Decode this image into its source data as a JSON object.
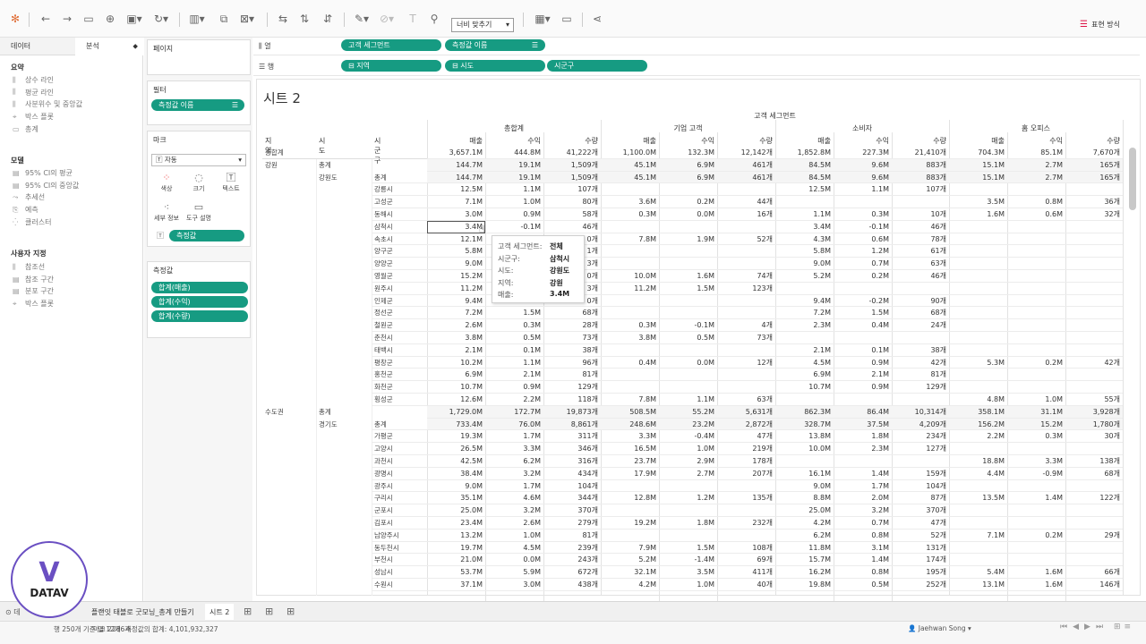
{
  "toolbar": {
    "fit_label": "너비 맞추기",
    "show_me": "표현 방식"
  },
  "left_panel": {
    "tab_data": "데이터",
    "tab_analysis": "분석",
    "summary": {
      "title": "요약",
      "items": [
        "상수 라인",
        "평균 라인",
        "사분위수 및 중앙값",
        "박스 플롯",
        "총계"
      ]
    },
    "model": {
      "title": "모델",
      "items": [
        "95% CI의 평균",
        "95% CI의 중앙값",
        "추세선",
        "예측",
        "클러스터"
      ]
    },
    "custom": {
      "title": "사용자 지정",
      "items": [
        "참조선",
        "참조 구간",
        "분포 구간",
        "박스 플롯"
      ]
    }
  },
  "cards": {
    "pages": "페이지",
    "filters": "필터",
    "filter_pill": "측정값 이름",
    "marks": "마크",
    "mark_type": "자동",
    "mark_buttons": [
      "색상",
      "크기",
      "텍스트",
      "세부 정보",
      "도구 설명"
    ],
    "marks_pill": "측정값",
    "measures": "측정값",
    "measure_pills": [
      "합계(매출)",
      "합계(수익)",
      "합계(수량)"
    ]
  },
  "shelves": {
    "columns_label": "열",
    "rows_label": "행",
    "columns_pills": [
      "고객 세그먼트",
      "측정값 이름"
    ],
    "rows_pills": [
      "지역",
      "시도",
      "시군구"
    ]
  },
  "sheet": {
    "title": "시트 2",
    "header_top": "고객 세그먼트",
    "segments": [
      "총합계",
      "기업 고객",
      "소비자",
      "홈 오피스"
    ],
    "measures": [
      "매출",
      "수익",
      "수량"
    ],
    "row_headers": [
      "지역",
      "시도",
      "시군구"
    ],
    "grand_total_label": "총합계",
    "grand_total": [
      "3,657.1M",
      "444.8M",
      "41,222개",
      "1,100.0M",
      "132.3M",
      "12,142개",
      "1,852.8M",
      "227.3M",
      "21,410개",
      "704.3M",
      "85.1M",
      "7,670개"
    ],
    "rows": [
      {
        "region": "강원",
        "prov": "총계",
        "city": "",
        "v": [
          "144.7M",
          "19.1M",
          "1,509개",
          "45.1M",
          "6.9M",
          "461개",
          "84.5M",
          "9.6M",
          "883개",
          "15.1M",
          "2.7M",
          "165개"
        ]
      },
      {
        "region": "",
        "prov": "강원도",
        "city": "총계",
        "v": [
          "144.7M",
          "19.1M",
          "1,509개",
          "45.1M",
          "6.9M",
          "461개",
          "84.5M",
          "9.6M",
          "883개",
          "15.1M",
          "2.7M",
          "165개"
        ]
      },
      {
        "region": "",
        "prov": "",
        "city": "강릉시",
        "v": [
          "12.5M",
          "1.1M",
          "107개",
          "",
          "",
          "",
          "12.5M",
          "1.1M",
          "107개",
          "",
          "",
          ""
        ]
      },
      {
        "region": "",
        "prov": "",
        "city": "고성군",
        "v": [
          "7.1M",
          "1.0M",
          "80개",
          "3.6M",
          "0.2M",
          "44개",
          "",
          "",
          "",
          "3.5M",
          "0.8M",
          "36개"
        ]
      },
      {
        "region": "",
        "prov": "",
        "city": "동해시",
        "v": [
          "3.0M",
          "0.9M",
          "58개",
          "0.3M",
          "0.0M",
          "16개",
          "1.1M",
          "0.3M",
          "10개",
          "1.6M",
          "0.6M",
          "32개"
        ]
      },
      {
        "region": "",
        "prov": "",
        "city": "삼척시",
        "v": [
          "3.4M",
          "-0.1M",
          "46개",
          "",
          "",
          "",
          "3.4M",
          "-0.1M",
          "46개",
          "",
          "",
          ""
        ]
      },
      {
        "region": "",
        "prov": "",
        "city": "속초시",
        "v": [
          "12.1M",
          "",
          "0개",
          "7.8M",
          "1.9M",
          "52개",
          "4.3M",
          "0.6M",
          "78개",
          "",
          "",
          ""
        ]
      },
      {
        "region": "",
        "prov": "",
        "city": "양구군",
        "v": [
          "5.8M",
          "",
          "1개",
          "",
          "",
          "",
          "5.8M",
          "1.2M",
          "61개",
          "",
          "",
          ""
        ]
      },
      {
        "region": "",
        "prov": "",
        "city": "양양군",
        "v": [
          "9.0M",
          "",
          "3개",
          "",
          "",
          "",
          "9.0M",
          "0.7M",
          "63개",
          "",
          "",
          ""
        ]
      },
      {
        "region": "",
        "prov": "",
        "city": "영월군",
        "v": [
          "15.2M",
          "",
          "0개",
          "10.0M",
          "1.6M",
          "74개",
          "5.2M",
          "0.2M",
          "46개",
          "",
          "",
          ""
        ]
      },
      {
        "region": "",
        "prov": "",
        "city": "원주시",
        "v": [
          "11.2M",
          "",
          "3개",
          "11.2M",
          "1.5M",
          "123개",
          "",
          "",
          "",
          "",
          "",
          ""
        ]
      },
      {
        "region": "",
        "prov": "",
        "city": "인제군",
        "v": [
          "9.4M",
          "",
          "0개",
          "",
          "",
          "",
          "9.4M",
          "-0.2M",
          "90개",
          "",
          "",
          ""
        ]
      },
      {
        "region": "",
        "prov": "",
        "city": "정선군",
        "v": [
          "7.2M",
          "1.5M",
          "68개",
          "",
          "",
          "",
          "7.2M",
          "1.5M",
          "68개",
          "",
          "",
          ""
        ]
      },
      {
        "region": "",
        "prov": "",
        "city": "철원군",
        "v": [
          "2.6M",
          "0.3M",
          "28개",
          "0.3M",
          "-0.1M",
          "4개",
          "2.3M",
          "0.4M",
          "24개",
          "",
          "",
          ""
        ]
      },
      {
        "region": "",
        "prov": "",
        "city": "춘천시",
        "v": [
          "3.8M",
          "0.5M",
          "73개",
          "3.8M",
          "0.5M",
          "73개",
          "",
          "",
          "",
          "",
          "",
          ""
        ]
      },
      {
        "region": "",
        "prov": "",
        "city": "태백시",
        "v": [
          "2.1M",
          "0.1M",
          "38개",
          "",
          "",
          "",
          "2.1M",
          "0.1M",
          "38개",
          "",
          "",
          ""
        ]
      },
      {
        "region": "",
        "prov": "",
        "city": "평창군",
        "v": [
          "10.2M",
          "1.1M",
          "96개",
          "0.4M",
          "0.0M",
          "12개",
          "4.5M",
          "0.9M",
          "42개",
          "5.3M",
          "0.2M",
          "42개"
        ]
      },
      {
        "region": "",
        "prov": "",
        "city": "홍천군",
        "v": [
          "6.9M",
          "2.1M",
          "81개",
          "",
          "",
          "",
          "6.9M",
          "2.1M",
          "81개",
          "",
          "",
          ""
        ]
      },
      {
        "region": "",
        "prov": "",
        "city": "화천군",
        "v": [
          "10.7M",
          "0.9M",
          "129개",
          "",
          "",
          "",
          "10.7M",
          "0.9M",
          "129개",
          "",
          "",
          ""
        ]
      },
      {
        "region": "",
        "prov": "",
        "city": "횡성군",
        "v": [
          "12.6M",
          "2.2M",
          "118개",
          "7.8M",
          "1.1M",
          "63개",
          "",
          "",
          "",
          "4.8M",
          "1.0M",
          "55개"
        ]
      },
      {
        "region": "수도권",
        "prov": "총계",
        "city": "",
        "v": [
          "1,729.0M",
          "172.7M",
          "19,873개",
          "508.5M",
          "55.2M",
          "5,631개",
          "862.3M",
          "86.4M",
          "10,314개",
          "358.1M",
          "31.1M",
          "3,928개"
        ]
      },
      {
        "region": "",
        "prov": "경기도",
        "city": "총계",
        "v": [
          "733.4M",
          "76.0M",
          "8,861개",
          "248.6M",
          "23.2M",
          "2,872개",
          "328.7M",
          "37.5M",
          "4,209개",
          "156.2M",
          "15.2M",
          "1,780개"
        ]
      },
      {
        "region": "",
        "prov": "",
        "city": "가평군",
        "v": [
          "19.3M",
          "1.7M",
          "311개",
          "3.3M",
          "-0.4M",
          "47개",
          "13.8M",
          "1.8M",
          "234개",
          "2.2M",
          "0.3M",
          "30개"
        ]
      },
      {
        "region": "",
        "prov": "",
        "city": "고양시",
        "v": [
          "26.5M",
          "3.3M",
          "346개",
          "16.5M",
          "1.0M",
          "219개",
          "10.0M",
          "2.3M",
          "127개",
          "",
          "",
          ""
        ]
      },
      {
        "region": "",
        "prov": "",
        "city": "과천시",
        "v": [
          "42.5M",
          "6.2M",
          "316개",
          "23.7M",
          "2.9M",
          "178개",
          "",
          "",
          "",
          "18.8M",
          "3.3M",
          "138개"
        ]
      },
      {
        "region": "",
        "prov": "",
        "city": "광명시",
        "v": [
          "38.4M",
          "3.2M",
          "434개",
          "17.9M",
          "2.7M",
          "207개",
          "16.1M",
          "1.4M",
          "159개",
          "4.4M",
          "-0.9M",
          "68개"
        ]
      },
      {
        "region": "",
        "prov": "",
        "city": "광주시",
        "v": [
          "9.0M",
          "1.7M",
          "104개",
          "",
          "",
          "",
          "9.0M",
          "1.7M",
          "104개",
          "",
          "",
          ""
        ]
      },
      {
        "region": "",
        "prov": "",
        "city": "구리시",
        "v": [
          "35.1M",
          "4.6M",
          "344개",
          "12.8M",
          "1.2M",
          "135개",
          "8.8M",
          "2.0M",
          "87개",
          "13.5M",
          "1.4M",
          "122개"
        ]
      },
      {
        "region": "",
        "prov": "",
        "city": "군포시",
        "v": [
          "25.0M",
          "3.2M",
          "370개",
          "",
          "",
          "",
          "25.0M",
          "3.2M",
          "370개",
          "",
          "",
          ""
        ]
      },
      {
        "region": "",
        "prov": "",
        "city": "김포시",
        "v": [
          "23.4M",
          "2.6M",
          "279개",
          "19.2M",
          "1.8M",
          "232개",
          "4.2M",
          "0.7M",
          "47개",
          "",
          "",
          ""
        ]
      },
      {
        "region": "",
        "prov": "",
        "city": "남양주시",
        "v": [
          "13.2M",
          "1.0M",
          "81개",
          "",
          "",
          "",
          "6.2M",
          "0.8M",
          "52개",
          "7.1M",
          "0.2M",
          "29개"
        ]
      },
      {
        "region": "",
        "prov": "",
        "city": "동두천시",
        "v": [
          "19.7M",
          "4.5M",
          "239개",
          "7.9M",
          "1.5M",
          "108개",
          "11.8M",
          "3.1M",
          "131개",
          "",
          "",
          ""
        ]
      },
      {
        "region": "",
        "prov": "",
        "city": "부천시",
        "v": [
          "21.0M",
          "0.0M",
          "243개",
          "5.2M",
          "-1.4M",
          "69개",
          "15.7M",
          "1.4M",
          "174개",
          "",
          "",
          ""
        ]
      },
      {
        "region": "",
        "prov": "",
        "city": "성남시",
        "v": [
          "53.7M",
          "5.9M",
          "672개",
          "32.1M",
          "3.5M",
          "411개",
          "16.2M",
          "0.8M",
          "195개",
          "5.4M",
          "1.6M",
          "66개"
        ]
      },
      {
        "region": "",
        "prov": "",
        "city": "수원시",
        "v": [
          "37.1M",
          "3.0M",
          "438개",
          "4.2M",
          "1.0M",
          "40개",
          "19.8M",
          "0.5M",
          "252개",
          "13.1M",
          "1.6M",
          "146개"
        ]
      }
    ]
  },
  "tooltip": {
    "rows": [
      {
        "k": "고객 세그먼트:",
        "v": "전체"
      },
      {
        "k": "시군구:",
        "v": "삼척시"
      },
      {
        "k": "시도:",
        "v": "강원도"
      },
      {
        "k": "지역:",
        "v": "강원"
      },
      {
        "k": "매출:",
        "v": "3.4M"
      }
    ]
  },
  "bottom_tabs": {
    "tab1": "데",
    "tab2": "플랜잇 태블로 굿모닝_총계 만들기",
    "tab3": "시트 2"
  },
  "status": {
    "marks": "마크 2286개",
    "rows": "행 250개 기준 열 12개",
    "sum": "측정값의 합계: 4,101,932,327",
    "user": "Jaehwan Song"
  },
  "logo": {
    "text": "DATAV"
  }
}
